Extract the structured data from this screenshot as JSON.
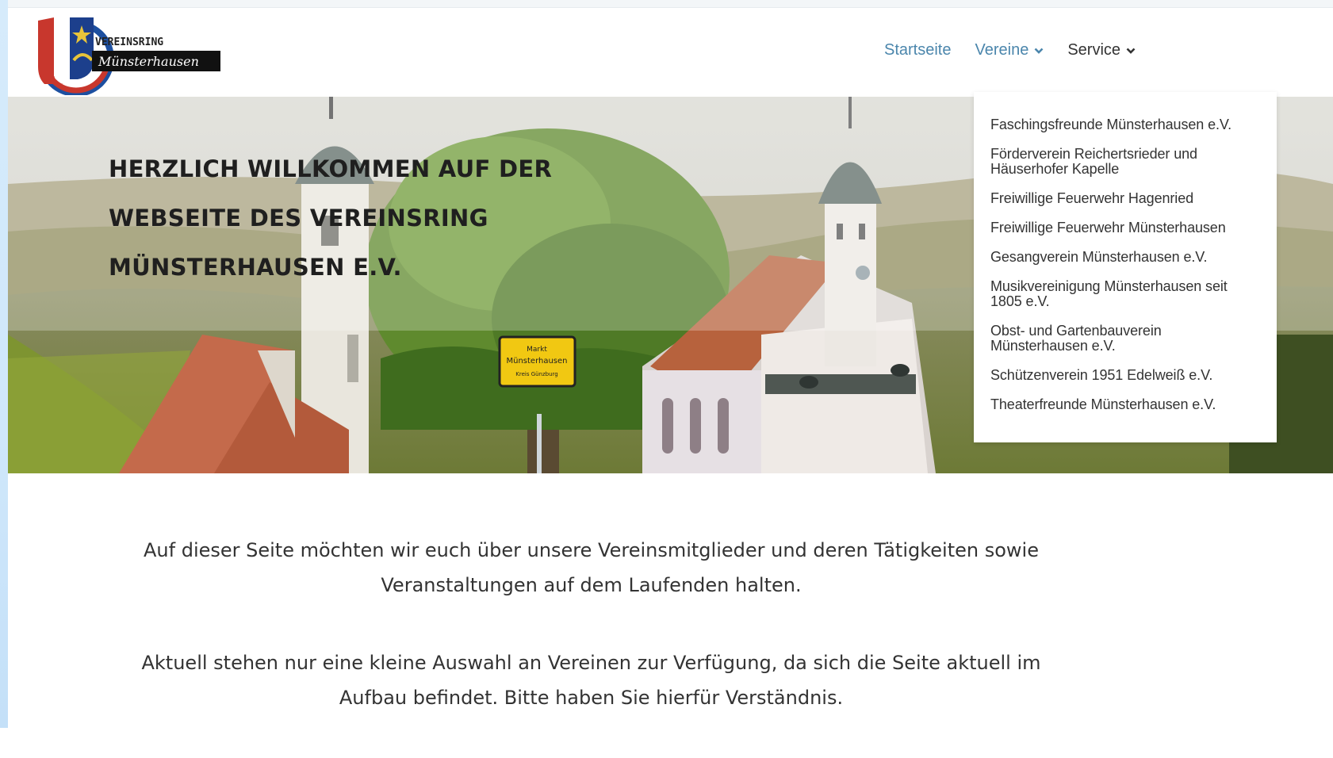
{
  "site": {
    "logo_line1": "VEREINSRING",
    "logo_line2": "Münsterhausen"
  },
  "nav": {
    "items": [
      {
        "label": "Startseite"
      },
      {
        "label": "Vereine"
      },
      {
        "label": "Service"
      }
    ]
  },
  "dropdown": {
    "items": [
      "Faschingsfreunde Münsterhausen e.V.",
      "Förderverein Reichertsrieder und Häuserhofer Kapelle",
      "Freiwillige Feuerwehr Hagenried",
      "Freiwillige Feuerwehr Münsterhausen",
      "Gesangverein Münsterhausen e.V.",
      "Musikvereinigung Münsterhausen seit 1805 e.V.",
      "Obst- und Gartenbauverein Münsterhausen e.V.",
      "Schützenverein 1951 Edelweiß e.V.",
      "Theaterfreunde Münsterhausen e.V."
    ]
  },
  "hero": {
    "title_lines": [
      "HERZLICH WILLKOMMEN AUF DER",
      "WEBSEITE DES VEREINSRING",
      "MÜNSTERHAUSEN E.V."
    ],
    "sign_line1": "Markt",
    "sign_line2": "Münsterhausen",
    "sign_line3": "Kreis Günzburg"
  },
  "content": {
    "paragraph1": "Auf dieser Seite möchten wir euch über unsere Vereinsmitglieder und deren Tätigkeiten sowie Veranstaltungen auf dem Laufenden halten.",
    "paragraph2": "Aktuell stehen nur eine kleine Auswahl an Vereinen zur Verfügung, da sich die Seite aktuell im Aufbau befindet. Bitte haben Sie hierfür Verständnis."
  },
  "colors": {
    "nav_active": "#4b86ac",
    "text": "#333333",
    "logo_red": "#c8372d",
    "logo_blue": "#1c3f8c"
  }
}
